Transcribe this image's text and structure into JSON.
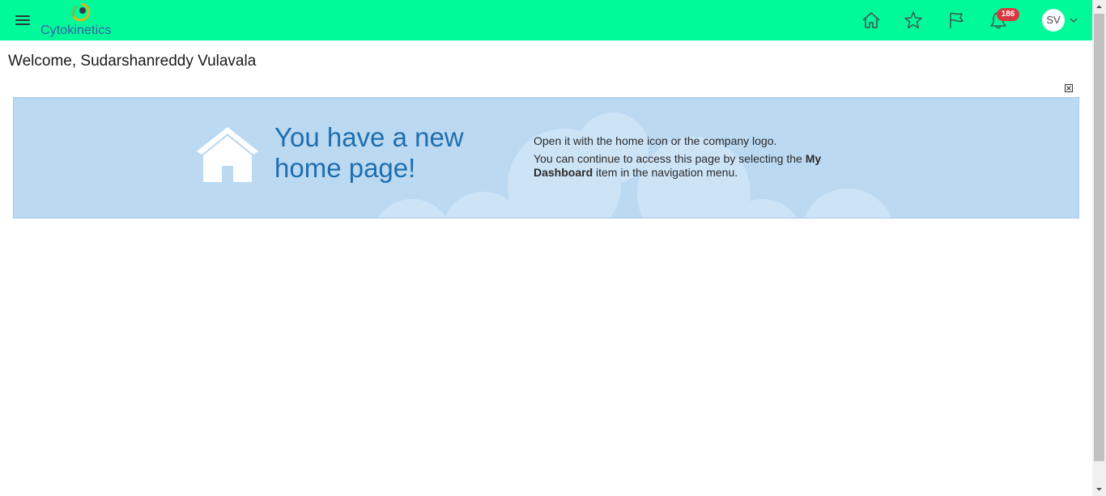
{
  "header": {
    "menu_icon": "hamburger-menu-icon",
    "logo_text": "Cytokinetics",
    "nav_icons": [
      "home-icon",
      "star-icon",
      "flag-icon",
      "bell-icon"
    ],
    "notification_count": "186",
    "avatar_initials": "SV",
    "bar_color": "#00fa9a"
  },
  "welcome": {
    "text": "Welcome, Sudarshanreddy Vulavala"
  },
  "banner": {
    "title": "You have a new home page!",
    "line1": "Open it with the home icon or the company logo.",
    "line2_prefix": "You can continue to access this page by selecting the ",
    "line2_bold": "My Dashboard",
    "line2_suffix": " item in the navigation menu.",
    "background_color": "#bcd9f2",
    "title_color": "#1e6fb0"
  }
}
